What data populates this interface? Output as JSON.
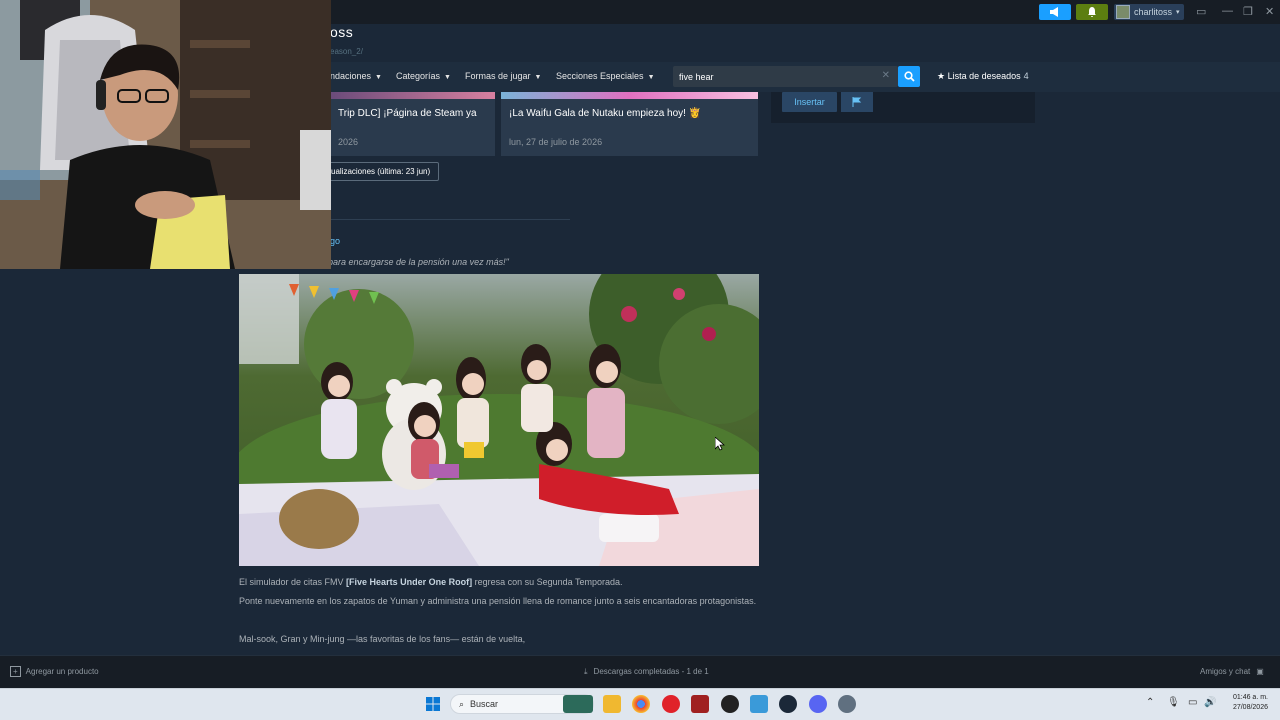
{
  "titlebar": {
    "username": "charlitoss",
    "accent_announce": "#1a9fff",
    "accent_notify": "#5c7e10"
  },
  "header": {
    "page_title": "oss",
    "page_url": "eason_2/"
  },
  "nav": {
    "items": [
      {
        "label": "ndaciones",
        "icon": "chevron-down-icon"
      },
      {
        "label": "Categorías",
        "icon": "chevron-down-icon"
      },
      {
        "label": "Formas de jugar",
        "icon": "chevron-down-icon"
      },
      {
        "label": "Secciones Especiales",
        "icon": "chevron-down-icon"
      }
    ],
    "search_value": "five hear",
    "wishlist_label": "Lista de deseados",
    "wishlist_count": "4"
  },
  "news": [
    {
      "title": "Trip DLC] ¡Página de Steam ya",
      "date": "2026"
    },
    {
      "title": "¡La Waifu Gala de Nutaku empieza hoy! 👸",
      "date": "lun, 27 de julio de 2026"
    }
  ],
  "sidebar": {
    "insert_label": "Insertar",
    "flag_icon": "flag-icon"
  },
  "updates": {
    "pill_label": "ualizaciones (última: 23 jun)"
  },
  "post": {
    "author": "go",
    "quote": "para encargarse de la pensión una vez más!\"",
    "para1_pre": "El simulador de citas FMV ",
    "para1_bold": "[Five Hearts Under One Roof]",
    "para1_post": " regresa con su Segunda Temporada.",
    "para2": "Ponte nuevamente en los zapatos de Yuman y administra una pensión llena de romance junto a seis encantadoras protagonistas.",
    "para3": "Mal-sook, Gran y Min-jung —las favoritas de los fans— están de vuelta,"
  },
  "bottombar": {
    "add_product": "Agregar un producto",
    "downloads": "Descargas completadas - 1 de 1",
    "friends": "Amigos y chat"
  },
  "taskbar": {
    "search_placeholder": "Buscar",
    "time": "01:46 a. m.",
    "date": "27/08/2026"
  }
}
